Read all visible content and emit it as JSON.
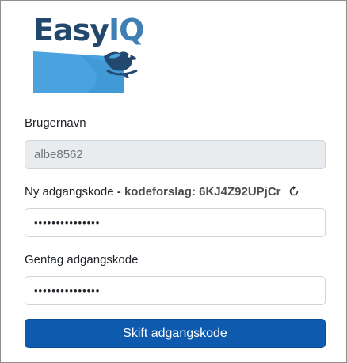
{
  "logo": {
    "part1": "Easy",
    "part2": "IQ",
    "colors": {
      "easy": "#23486e",
      "iq": "#3f7fb4",
      "wave": "#4aa3df"
    }
  },
  "form": {
    "username": {
      "label": "Brugernavn",
      "value": "albe8562"
    },
    "new_password": {
      "label": "Ny adgangskode",
      "separator": "-",
      "suggestion_prefix": "kodeforslag:",
      "suggestion_value": "6KJ4Z92UPjCr",
      "refresh_icon": "refresh-icon",
      "masked_value": "•••••••••••••••"
    },
    "repeat_password": {
      "label": "Gentag adgangskode",
      "masked_value": "•••••••••••••••"
    },
    "submit_label": "Skift adgangskode"
  },
  "colors": {
    "primary_button": "#0d5aae",
    "readonly_bg": "#e9ecef",
    "border": "#ced4da"
  }
}
